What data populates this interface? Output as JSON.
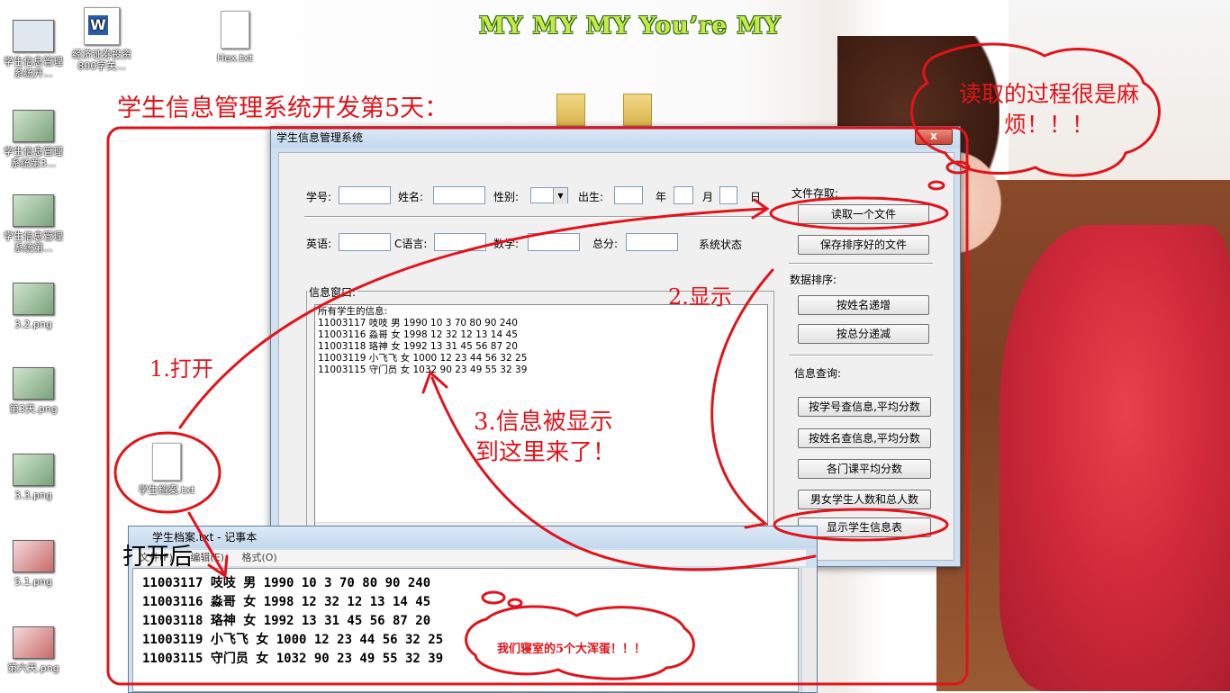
{
  "banner": "MY MY MY You’re MY",
  "desktop_icons": [
    {
      "label": "学生信息管理系统开..."
    },
    {
      "label": "经济证券投资800字关..."
    },
    {
      "label": "Hex.txt"
    },
    {
      "label": "学生信息管理系统第3..."
    },
    {
      "label": "学生信息管理系统第..."
    },
    {
      "label": "3.2.png"
    },
    {
      "label": "第3天.png"
    },
    {
      "label": "3.3.png"
    },
    {
      "label": "5.1.png"
    },
    {
      "label": "第六天.png"
    },
    {
      "label": "学生档案.txt"
    }
  ],
  "annotations": {
    "heading": "学生信息管理系统开发第5天：",
    "cloud_top": "读取的过程很是麻烦！！！",
    "step1": "1.打开",
    "step2": "2.显示",
    "step3_line1": "3.信息被显示",
    "step3_line2": "到这里来了！",
    "after_open": "打开后",
    "cloud_bottom": "我们寝室的5个大浑蛋！！！"
  },
  "dialog": {
    "title": "学生信息管理系统",
    "close": "x",
    "fields_row1": {
      "id_label": "学号:",
      "name_label": "姓名:",
      "gender_label": "性别:",
      "birth_label": "出生:",
      "year_label": "年",
      "month_label": "月",
      "day_label": "日"
    },
    "fields_row2": {
      "english_label": "英语:",
      "c_label": "C语言:",
      "math_label": "数学:",
      "total_label": "总分:",
      "status_label": "系统状态"
    },
    "file_group": {
      "label": "文件存取:",
      "read_button": "读取一个文件",
      "save_button": "保存排序好的文件"
    },
    "sort_group": {
      "label": "数据排序:",
      "by_name": "按姓名递增",
      "by_total": "按总分递减"
    },
    "query_group": {
      "label": "信息查询:",
      "by_id": "按学号查信息,平均分数",
      "by_name": "按姓名查信息,平均分数",
      "course_avg": "各门课平均分数",
      "gender_count": "男女学生人数和总人数",
      "show_table": "显示学生信息表"
    },
    "info_window": {
      "label": "信息窗口:",
      "lines": [
        "所有学生的信息:",
        "11003117 吱吱 男 1990 10 3 70 80 90 240",
        "11003116 淼哥 女 1998 12 32 12 13 14 45",
        "11003118 珞神 女 1992 13 31 45 56 87 20",
        "11003119 小飞飞 女 1000 12 23 44 56 32 25",
        "11003115 守门员 女 1032 90 23 49 55 32 39"
      ]
    }
  },
  "notepad": {
    "title": "学生档案.txt - 记事本",
    "menu": [
      "文件(F)",
      "编辑(E)",
      "格式(O)"
    ],
    "lines": [
      "11003117 吱吱 男 1990 10 3 70 80 90 240",
      "11003116 淼哥 女 1998 12 32 12 13 14 45",
      "11003118 珞神 女 1992 13 31 45 56 87 20",
      "11003119 小飞飞 女 1000 12 23 44 56 32 25",
      "11003115 守门员 女 1032 90 23 49 55 32 39"
    ]
  },
  "colors": {
    "annotation": "#e0141b",
    "banner": "#c6e84a"
  }
}
